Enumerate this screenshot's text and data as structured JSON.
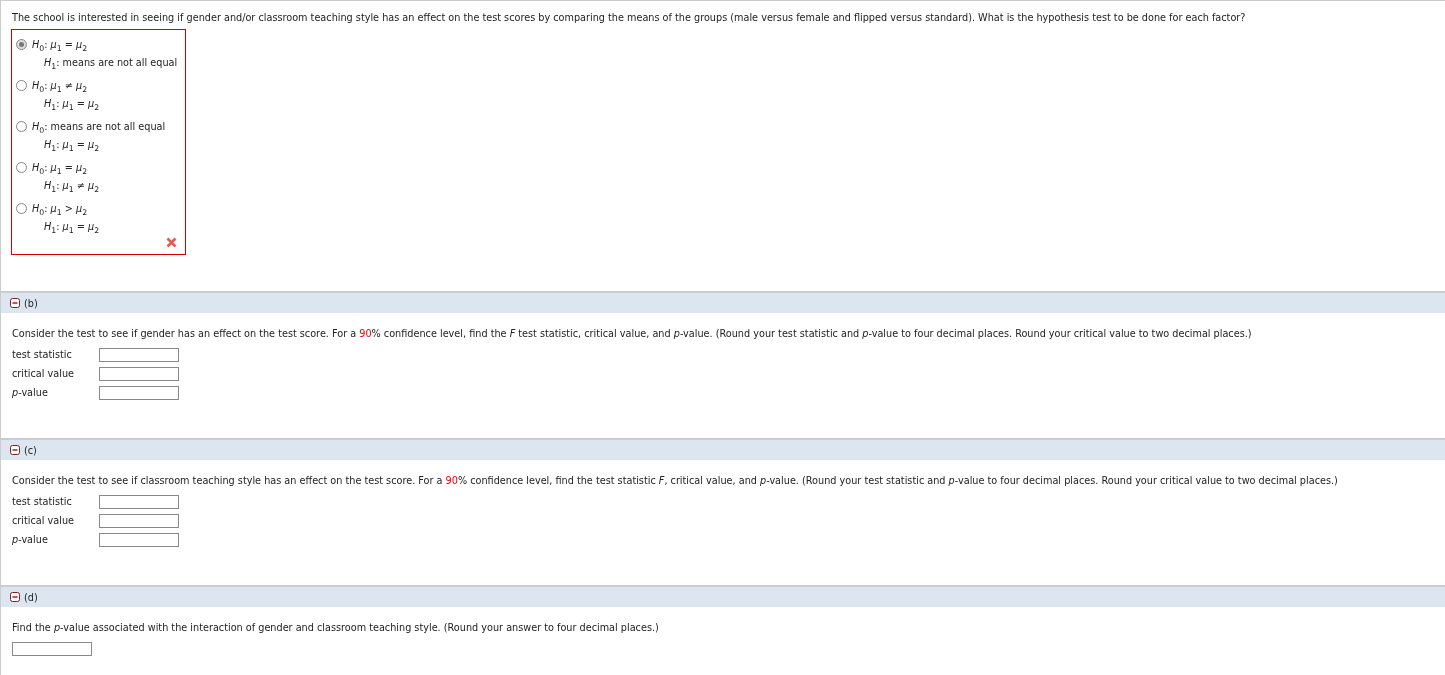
{
  "question": "The school is interested in seeing if gender and/or classroom teaching style has an effect on the test scores by comparing the means of the groups (male versus female and flipped versus standard). What is the hypothesis test to be done for each factor?",
  "choices": {
    "marked_incorrect": true,
    "options": [
      {
        "h0": "*H*$_{0}$: *μ*$_{1}$ = *μ*$_{2}$",
        "h1": "*H*$_{1}$: means are not all equal",
        "selected": true
      },
      {
        "h0": "*H*$_{0}$: *μ*$_{1}$ ≠ *μ*$_{2}$",
        "h1": "*H*$_{1}$: *μ*$_{1}$ = *μ*$_{2}$",
        "selected": false
      },
      {
        "h0": "*H*$_{0}$: means are not all equal",
        "h1": "*H*$_{1}$: *μ*$_{1}$ = *μ*$_{2}$",
        "selected": false
      },
      {
        "h0": "*H*$_{0}$: *μ*$_{1}$ = *μ*$_{2}$",
        "h1": "*H*$_{1}$: *μ*$_{1}$ ≠ *μ*$_{2}$",
        "selected": false
      },
      {
        "h0": "*H*$_{0}$: *μ*$_{1}$ > *μ*$_{2}$",
        "h1": "*H*$_{1}$: *μ*$_{1}$ = *μ*$_{2}$",
        "selected": false
      }
    ]
  },
  "sections": [
    {
      "label": "(b)",
      "expanded": true,
      "prompt": [
        {
          "text": "Consider the test to see if gender has an effect on the test score. For a ",
          "highlight": false
        },
        {
          "text": "90",
          "highlight": true
        },
        {
          "text": "% confidence level, find the *F* test statistic, critical value, and *p*-value. (Round your test statistic and *p*-value to four decimal places. Round your critical value to two decimal places.)",
          "highlight": false
        }
      ],
      "fields": [
        {
          "label": "test statistic"
        },
        {
          "label": "critical value"
        },
        {
          "label": "*p*-value"
        }
      ]
    },
    {
      "label": "(c)",
      "expanded": true,
      "prompt": [
        {
          "text": "Consider the test to see if classroom teaching style has an effect on the test score. For a ",
          "highlight": false
        },
        {
          "text": "90",
          "highlight": true
        },
        {
          "text": "% confidence level, find the test statistic *F*, critical value, and *p*-value. (Round your test statistic and *p*-value to four decimal places. Round your critical value to two decimal places.)",
          "highlight": false
        }
      ],
      "fields": [
        {
          "label": "test statistic"
        },
        {
          "label": "critical value"
        },
        {
          "label": "*p*-value"
        }
      ]
    },
    {
      "label": "(d)",
      "expanded": true,
      "prompt": [
        {
          "text": "Find the *p*-value associated with the interaction of gender and classroom teaching style. (Round your answer to four decimal places.)",
          "highlight": false
        }
      ],
      "fields": [
        {
          "kind": "bare"
        }
      ]
    }
  ]
}
